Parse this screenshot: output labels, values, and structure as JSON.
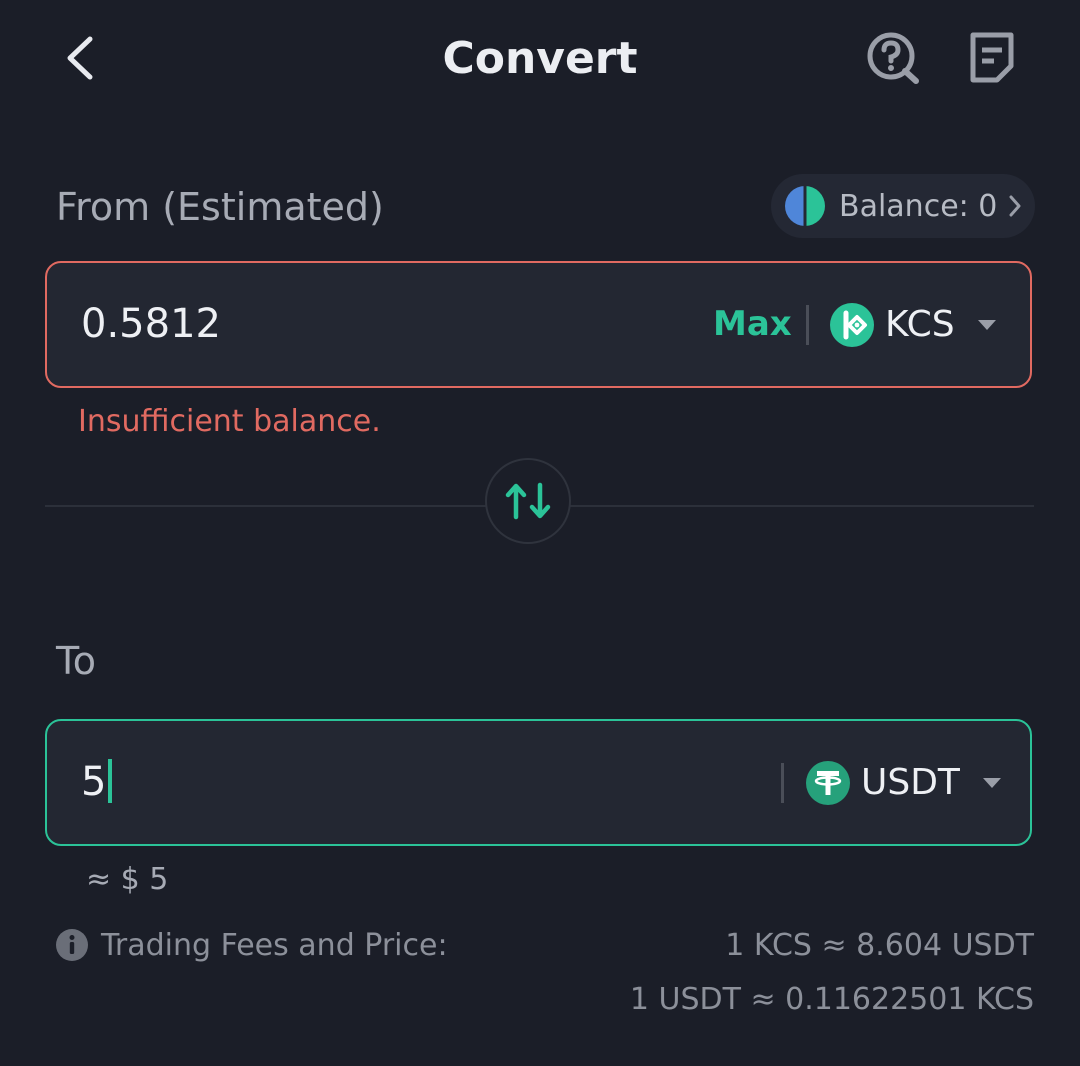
{
  "header": {
    "title": "Convert",
    "icons": {
      "back": "chevron-left-icon",
      "help": "help-search-icon",
      "orders": "order-history-icon"
    }
  },
  "from": {
    "label": "From (Estimated)",
    "balance_text": "Balance: 0",
    "amount": "0.5812",
    "max_label": "Max",
    "token": "KCS",
    "error": "Insufficient balance."
  },
  "to": {
    "label": "To",
    "amount": "5",
    "token": "USDT",
    "usd_estimate": "≈ $ 5"
  },
  "fees": {
    "label": "Trading Fees and Price:",
    "rate_1": "1 KCS ≈ 8.604 USDT",
    "rate_2": "1 USDT ≈ 0.11622501 KCS"
  },
  "colors": {
    "background": "#1b1e28",
    "accent_green": "#2bc398",
    "error_red": "#e16a61",
    "input_bg": "#232732"
  }
}
